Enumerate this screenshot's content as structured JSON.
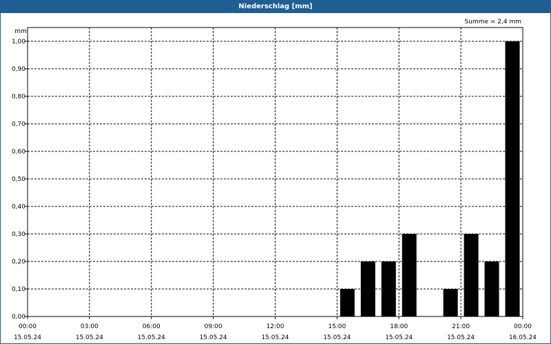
{
  "window": {
    "title": "Niederschlag [mm]"
  },
  "annotation": "Summe = 2,4 mm",
  "colors": {
    "titlebar": "#1f5d95",
    "bars": "#000000",
    "grid": "#000000"
  },
  "chart_data": {
    "type": "bar",
    "title": "Niederschlag [mm]",
    "ylabel": "mm",
    "xlabel": "",
    "ylim": [
      0,
      1.0
    ],
    "yticks": [
      "0,00",
      "0,10",
      "0,20",
      "0,30",
      "0,40",
      "0,50",
      "0,60",
      "0,70",
      "0,80",
      "0,90",
      "1,00"
    ],
    "xlim": [
      "15.05.24 00:00",
      "16.05.24 00:00"
    ],
    "xticks": [
      {
        "time": "00:00",
        "date": "15.05.24"
      },
      {
        "time": "03:00",
        "date": "15.05.24"
      },
      {
        "time": "06:00",
        "date": "15.05.24"
      },
      {
        "time": "09:00",
        "date": "15.05.24"
      },
      {
        "time": "12:00",
        "date": "15.05.24"
      },
      {
        "time": "15:00",
        "date": "15.05.24"
      },
      {
        "time": "18:00",
        "date": "15.05.24"
      },
      {
        "time": "21:00",
        "date": "15.05.24"
      },
      {
        "time": "00:00",
        "date": "16.05.24"
      }
    ],
    "grid": true,
    "bars": [
      {
        "start": "15:00",
        "end": "16:00",
        "value": 0.1
      },
      {
        "start": "16:00",
        "end": "17:00",
        "value": 0.2
      },
      {
        "start": "17:00",
        "end": "18:00",
        "value": 0.2
      },
      {
        "start": "18:00",
        "end": "19:00",
        "value": 0.3
      },
      {
        "start": "20:00",
        "end": "21:00",
        "value": 0.1
      },
      {
        "start": "21:00",
        "end": "22:00",
        "value": 0.3
      },
      {
        "start": "22:00",
        "end": "23:00",
        "value": 0.2
      },
      {
        "start": "23:00",
        "end": "24:00",
        "value": 1.0
      }
    ]
  }
}
